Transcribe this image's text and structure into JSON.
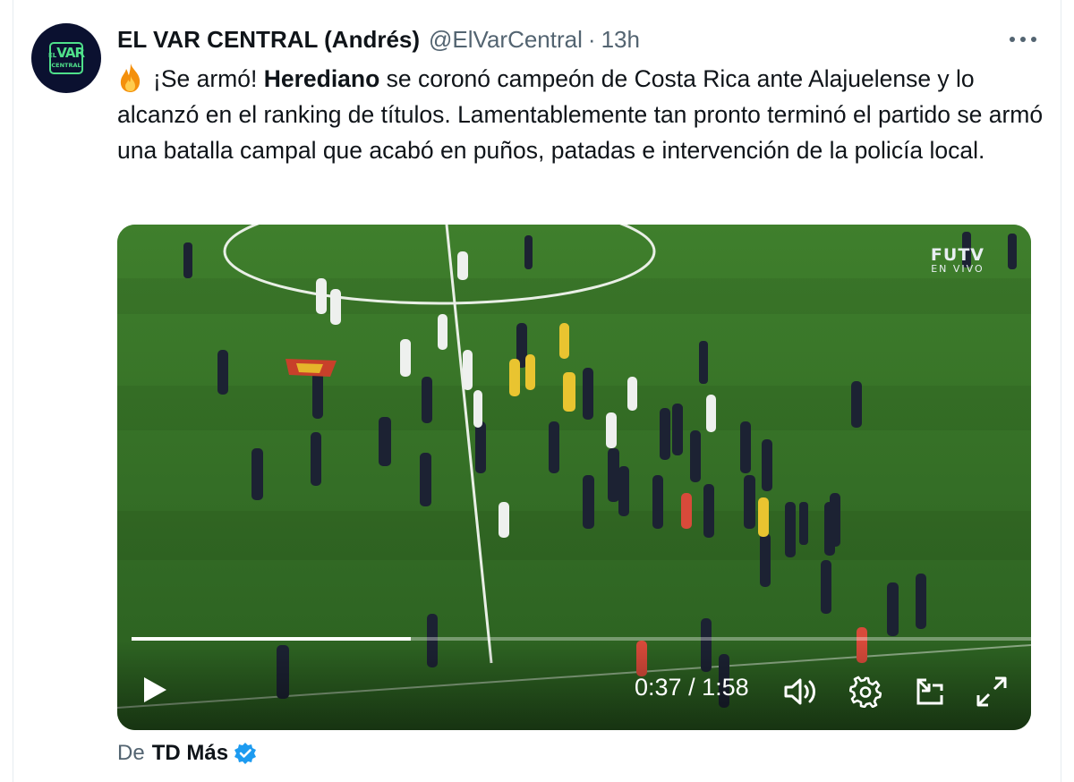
{
  "tweet": {
    "author_name": "EL VAR CENTRAL (Andrés)",
    "handle": "@ElVarCentral",
    "separator": "·",
    "time": "13h",
    "avatar_text_line1": "VAR",
    "avatar_text_line1_prefix": "EL",
    "avatar_text_line2": "CENTRAL",
    "text_part1": "¡Se armó! ",
    "text_bold": "Herediano",
    "text_part2": " se coronó campeón de Costa Rica ante Alajuelense y lo alcanzó en el ranking de títulos. Lamentablemente tan pronto terminó el partido se armó una batalla campal que acabó en puños, patadas e intervención de la policía local."
  },
  "video": {
    "brand_line1": "FUTV",
    "brand_line2": "EN VIVO",
    "current_time": "0:37",
    "time_separator": " / ",
    "duration": "1:58",
    "progress_fraction": 0.31
  },
  "footer": {
    "prefix": "De",
    "source": "TD Más"
  },
  "icons": {
    "more": "more-horizontal-icon",
    "fire": "fire-emoji-icon",
    "play": "play-icon",
    "volume": "volume-icon",
    "settings": "gear-icon",
    "popout": "popout-icon",
    "fullscreen": "fullscreen-icon",
    "verified": "verified-badge-icon"
  },
  "colors": {
    "text_primary": "#0f1419",
    "text_secondary": "#536471",
    "verified_blue": "#1d9bf0",
    "avatar_bg": "#0b1130",
    "avatar_accent": "#4fe08a"
  }
}
